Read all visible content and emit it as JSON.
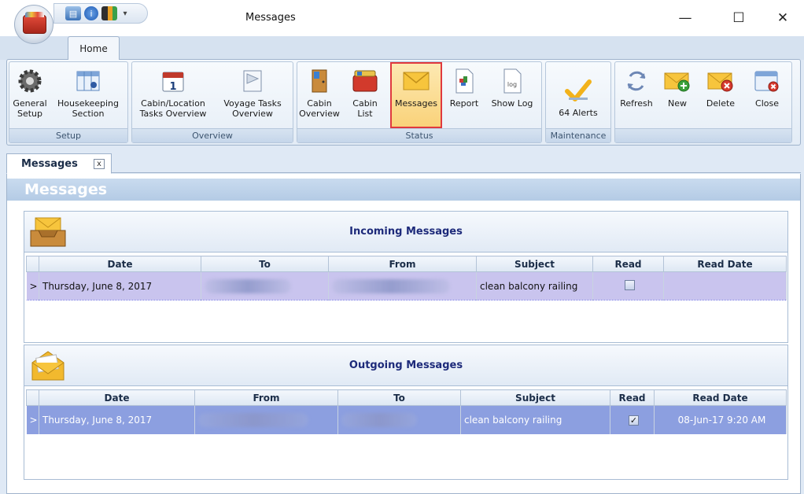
{
  "window": {
    "title": "Messages",
    "minimize": "—",
    "maximize": "☐",
    "close": "✕"
  },
  "qat": {
    "menu_glyph": "▾"
  },
  "ribbon": {
    "tab_home": "Home",
    "groups": {
      "setup": "Setup",
      "overview": "Overview",
      "status": "Status",
      "maintenance": "Maintenance"
    },
    "buttons": {
      "general_setup_1": "General",
      "general_setup_2": "Setup",
      "housekeeping_1": "Housekeeping",
      "housekeeping_2": "Section",
      "cabin_location_1": "Cabin/Location",
      "cabin_location_2": "Tasks Overview",
      "voyage_tasks_1": "Voyage Tasks",
      "voyage_tasks_2": "Overview",
      "cabin_overview_1": "Cabin",
      "cabin_overview_2": "Overview",
      "cabin_list_1": "Cabin",
      "cabin_list_2": "List",
      "messages": "Messages",
      "report": "Report",
      "show_log": "Show Log",
      "alerts": "64 Alerts",
      "refresh": "Refresh",
      "new": "New",
      "delete": "Delete",
      "close": "Close"
    },
    "icon_texts": {
      "calendar_day": "1",
      "log": "log"
    }
  },
  "doc_tab": {
    "label": "Messages",
    "close": "x"
  },
  "content": {
    "header": "Messages"
  },
  "incoming": {
    "title": "Incoming Messages",
    "columns": [
      "Date",
      "To",
      "From",
      "Subject",
      "Read",
      "Read Date"
    ],
    "row": {
      "date": "Thursday, June 8, 2017",
      "subject": "clean balcony railing",
      "read": false,
      "read_date": ""
    }
  },
  "outgoing": {
    "title": "Outgoing Messages",
    "columns": [
      "Date",
      "From",
      "To",
      "Subject",
      "Read",
      "Read Date"
    ],
    "row": {
      "date": "Thursday, June 8, 2017",
      "subject": "clean balcony railing",
      "read": true,
      "read_date": "08-Jun-17 9:20 AM"
    }
  },
  "row_indicator": ">",
  "colors": {
    "incoming_row": "#c9c4ee",
    "outgoing_row": "#8c9fe0",
    "header_text": "#1d2a7a",
    "selected_border": "#e0393e"
  }
}
